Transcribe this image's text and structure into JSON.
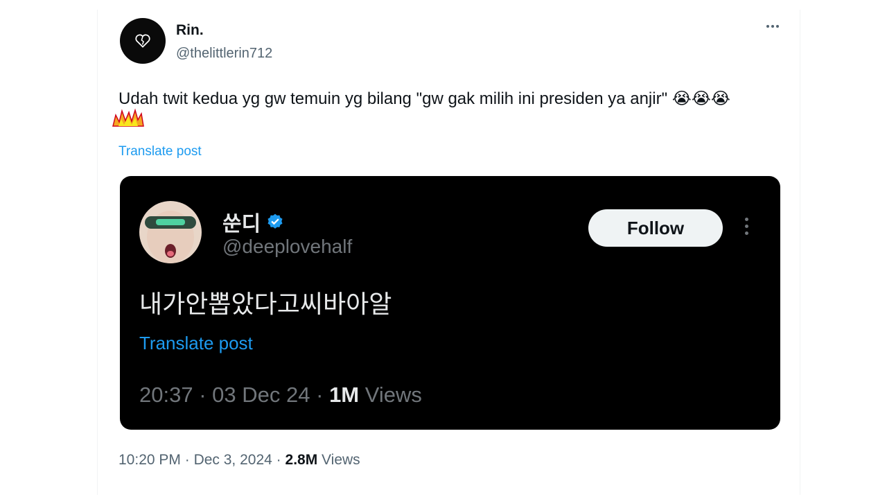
{
  "tweet": {
    "display_name": "Rin.",
    "handle": "@thelittlerin712",
    "text": "Udah twit kedua yg gw temuin yg bilang \"gw gak milih ini presiden ya anjir\" 😭😭😭",
    "translate_label": "Translate post",
    "time": "10:20 PM",
    "date": "Dec 3, 2024",
    "views_count": "2.8M",
    "views_label": "Views",
    "separator": "·"
  },
  "quoted": {
    "display_name": "쑨디",
    "handle": "@deeplovehalf",
    "follow_label": "Follow",
    "text": "내가안뽑았다고씨바아알",
    "translate_label": "Translate post",
    "time": "20:37",
    "date": "03 Dec 24",
    "views_count": "1M",
    "views_label": "Views",
    "separator": "·"
  },
  "icons": {
    "more": "more-horizontal-icon",
    "verified": "verified-badge-icon",
    "avatar_logo": "broken-heart-icon",
    "sticker": "fire-sticker-icon"
  },
  "colors": {
    "link_blue": "#1d9bf0",
    "verified_blue": "#1d9bf0",
    "embed_bg": "#000000",
    "secondary_text": "#536471"
  }
}
